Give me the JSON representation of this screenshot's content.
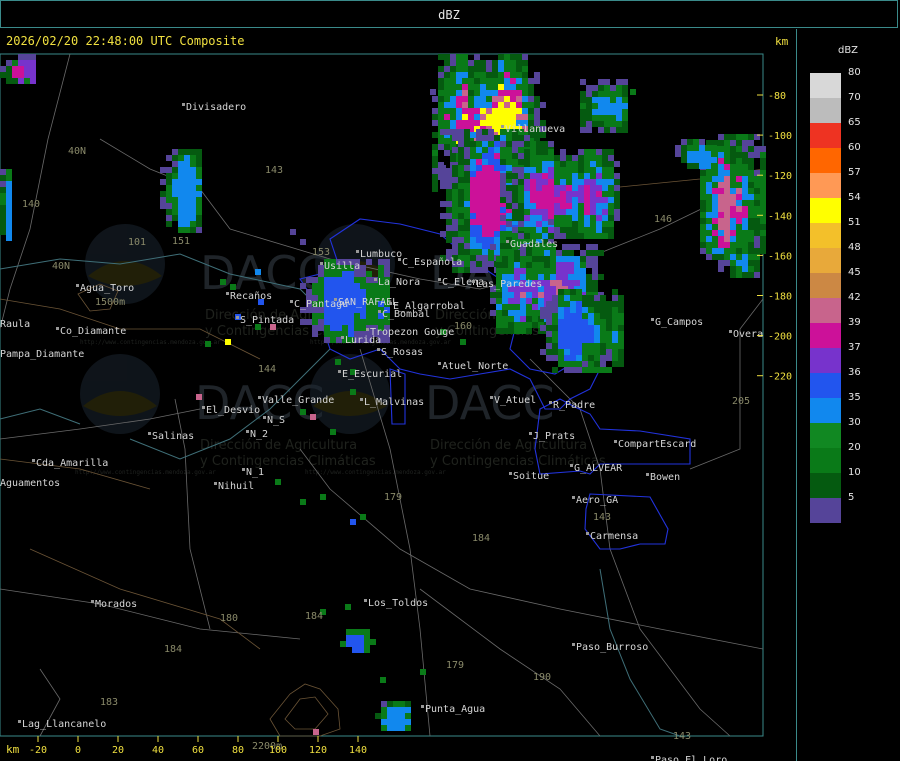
{
  "header": {
    "title": "dBZ"
  },
  "map": {
    "timestamp": "2026/02/20 22:48:00 UTC Composite",
    "unit_y": "km",
    "unit_x": "km",
    "y_ticks": [
      "-80",
      "-100",
      "-120",
      "-140",
      "-160",
      "-180",
      "-200",
      "-220"
    ],
    "x_ticks": [
      "-20",
      "0",
      "20",
      "40",
      "60",
      "80",
      "100",
      "120",
      "140"
    ],
    "place_labels": [
      "Divisadero",
      "Lumbuco",
      "Usilla",
      "C_Española",
      "La_Nora",
      "C_Elena",
      "Las_Paredes",
      "S_Pintada",
      "Recaños",
      "C_Pantagú",
      "SAN_RAFAEL",
      "E_Algarrobal",
      "C_Bombal",
      "Tropezon Gouge",
      "Lurida",
      "S_Rosas",
      "Atuel_Norte",
      "E_Escurial",
      "Valle_Grande",
      "L_Malvinas",
      "V_Atuel",
      "R_Padre",
      "El_Desvio",
      "Salinas",
      "N_2",
      "N_S",
      "N_1",
      "Nihuil",
      "J_Prats",
      "CompartEscard",
      "G_ALVEAR",
      "Bowen",
      "Soitue",
      "Aero_GA",
      "Carmensa",
      "Guadales",
      "G_Campos",
      "Overa",
      "Agua_Toro",
      "Co_Diamante",
      "Pampa_Diamante",
      "Cda_Amarilla",
      "Aguamentos",
      "Morados",
      "Los_Toldos",
      "Paso_Burroso",
      "Punta_Agua",
      "Lag_Llancanelo",
      "Paso_El_Loro",
      "Villanueva",
      "Raula"
    ],
    "road_labels": [
      "40N",
      "40N",
      "143",
      "151",
      "153",
      "160",
      "146",
      "179",
      "184",
      "184",
      "180",
      "184",
      "183",
      "179",
      "190",
      "143",
      "143",
      "205",
      "140",
      "144",
      "101",
      "1500m",
      "2200m"
    ],
    "watermark": {
      "brand": "DACC",
      "line1": "Dirección de Agricultura",
      "line2": "y Contingencias Climáticas",
      "url": "http://www.contingencias.mendoza.gov.ar"
    }
  },
  "legend": {
    "title": "dBZ",
    "items": [
      {
        "label": "80",
        "color": "#d8d8d8"
      },
      {
        "label": "70",
        "color": "#bcbcbc"
      },
      {
        "label": "65",
        "color": "#ee3322"
      },
      {
        "label": "60",
        "color": "#ff6600"
      },
      {
        "label": "57",
        "color": "#ff9955"
      },
      {
        "label": "54",
        "color": "#ffff00"
      },
      {
        "label": "51",
        "color": "#f3c02a"
      },
      {
        "label": "48",
        "color": "#e8a93a"
      },
      {
        "label": "45",
        "color": "#cc8844"
      },
      {
        "label": "42",
        "color": "#c8648c"
      },
      {
        "label": "39",
        "color": "#cc1199"
      },
      {
        "label": "37",
        "color": "#7733cc"
      },
      {
        "label": "36",
        "color": "#2255ee"
      },
      {
        "label": "35",
        "color": "#1188ee"
      },
      {
        "label": "30",
        "color": "#118822"
      },
      {
        "label": "20",
        "color": "#0a7a18"
      },
      {
        "label": "10",
        "color": "#055a10"
      },
      {
        "label": "5",
        "color": "#554499"
      }
    ]
  }
}
